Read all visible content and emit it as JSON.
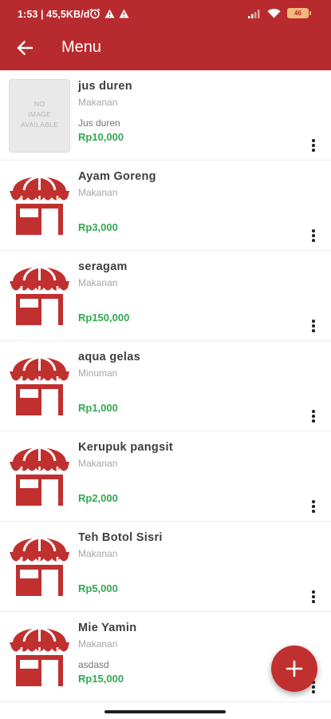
{
  "status_bar": {
    "time": "1:53 | 45,5KB/d",
    "battery": "46"
  },
  "header": {
    "title": "Menu"
  },
  "colors": {
    "brand": "#b72a2d",
    "price": "#33a852",
    "fab": "#c0302f"
  },
  "placeholder_image": {
    "line1": "NO",
    "line2": "IMAGE",
    "line3": "AVAILABLE"
  },
  "items": [
    {
      "name": "jus duren",
      "category": "Makanan",
      "description": "Jus duren",
      "price": "Rp10,000",
      "image": "no-image"
    },
    {
      "name": "Ayam Goreng",
      "category": "Makanan",
      "description": "",
      "price": "Rp3,000",
      "image": "shop-icon"
    },
    {
      "name": "seragam",
      "category": "Makanan",
      "description": "",
      "price": "Rp150,000",
      "image": "shop-icon"
    },
    {
      "name": "aqua gelas",
      "category": "Minuman",
      "description": "",
      "price": "Rp1,000",
      "image": "shop-icon"
    },
    {
      "name": "Kerupuk pangsit",
      "category": " Makanan",
      "description": "",
      "price": "Rp2,000",
      "image": "shop-icon"
    },
    {
      "name": "Teh Botol Sisri",
      "category": "Makanan",
      "description": "",
      "price": "Rp5,000",
      "image": "shop-icon"
    },
    {
      "name": "Mie Yamin",
      "category": "Makanan",
      "description": "asdasd",
      "price": "Rp15,000",
      "image": "shop-icon"
    }
  ],
  "fab": {
    "icon": "plus-icon"
  }
}
